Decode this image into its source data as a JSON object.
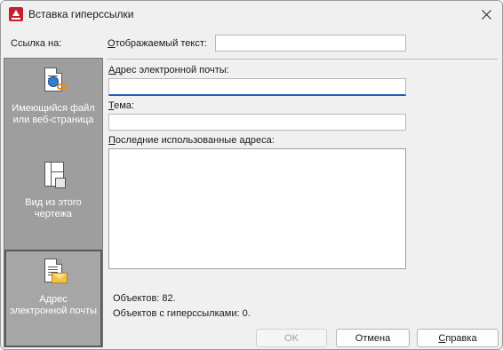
{
  "window": {
    "title": "Вставка гиперссылки",
    "accent": "#c8202b"
  },
  "link_to": {
    "label": "Ссылка на:",
    "items": [
      {
        "line1": "Имеющийся файл",
        "line2": "или веб-страница",
        "icon": "file-web-icon",
        "selected": false
      },
      {
        "line1": "Вид из этого",
        "line2": "чертежа",
        "icon": "drawing-view-icon",
        "selected": false
      },
      {
        "line1": "Адрес",
        "line2": "электронной почты",
        "icon": "email-address-icon",
        "selected": true
      }
    ]
  },
  "form": {
    "display_text_label_u": "О",
    "display_text_label_rest": "тображаемый текст:",
    "display_text_value": "",
    "email_label_u": "А",
    "email_label_rest": "дрес электронной почты:",
    "email_value": "",
    "subject_label_u": "Т",
    "subject_label_rest": "ема:",
    "subject_value": "",
    "recent_label_u": "П",
    "recent_label_rest": "оследние использованные адреса:",
    "recent_items": []
  },
  "info": {
    "objects": "Объектов: 82.",
    "objects_with_links": "Объектов с гиперссылками: 0."
  },
  "buttons": {
    "ok": "OK",
    "cancel": "Отмена",
    "help_u": "С",
    "help_rest": "правка"
  }
}
